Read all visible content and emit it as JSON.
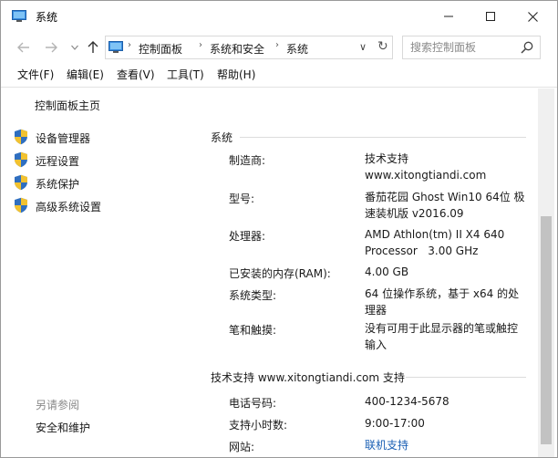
{
  "window": {
    "title": "系统",
    "minimize_icon": "minimize-icon",
    "maximize_icon": "maximize-icon",
    "close_icon": "close-icon"
  },
  "address_bar": {
    "breadcrumbs": [
      "控制面板",
      "系统和安全",
      "系统"
    ],
    "search_placeholder": "搜索控制面板"
  },
  "menu": {
    "items": [
      "文件(F)",
      "编辑(E)",
      "查看(V)",
      "工具(T)",
      "帮助(H)"
    ]
  },
  "sidebar": {
    "home": "控制面板主页",
    "links": [
      "设备管理器",
      "远程设置",
      "系统保护",
      "高级系统设置"
    ],
    "see_also_title": "另请参阅",
    "see_also_links": [
      "安全和维护"
    ]
  },
  "system_section": {
    "title": "系统",
    "rows": [
      {
        "label": "制造商:",
        "value": "技术支持\nwww.xitongtiandi.com"
      },
      {
        "label": "型号:",
        "value": "番茄花园 Ghost Win10 64位 极\n速装机版 v2016.09"
      },
      {
        "label": "处理器:",
        "value": "AMD Athlon(tm) II X4 640\nProcessor   3.00 GHz"
      },
      {
        "label": "已安装的内存(RAM):",
        "value": "4.00 GB"
      },
      {
        "label": "系统类型:",
        "value": "64 位操作系统，基于 x64 的处\n理器"
      },
      {
        "label": "笔和触摸:",
        "value": "没有可用于此显示器的笔或触控\n输入"
      }
    ]
  },
  "support_section": {
    "title": "技术支持 www.xitongtiandi.com 支持",
    "rows": [
      {
        "label": "电话号码:",
        "value": "400-1234-5678"
      },
      {
        "label": "支持小时数:",
        "value": "9:00-17:00"
      },
      {
        "label": "网站:",
        "value": "联机支持"
      }
    ]
  },
  "colors": {
    "link": "#1a5fb4",
    "shield_blue": "#2f6fc0",
    "shield_yellow": "#f2c230"
  }
}
